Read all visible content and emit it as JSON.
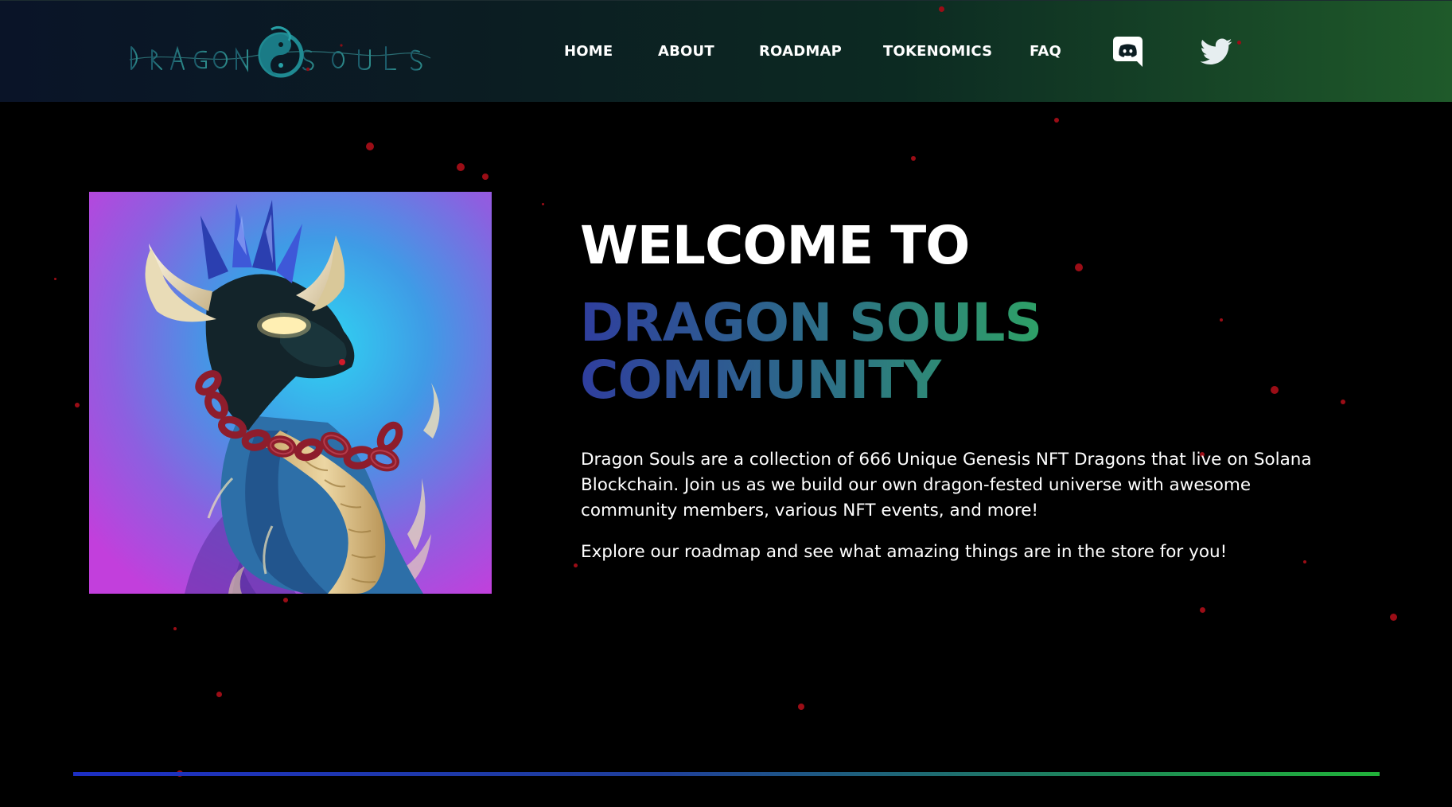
{
  "header": {
    "logo_text": "DRAGON SOULS",
    "nav": [
      {
        "label": "HOME"
      },
      {
        "label": "ABOUT"
      },
      {
        "label": "ROADMAP"
      },
      {
        "label": "TOKENOMICS"
      },
      {
        "label": "FAQ"
      }
    ],
    "social": [
      {
        "icon": "discord-icon"
      },
      {
        "icon": "twitter-icon"
      }
    ]
  },
  "hero": {
    "heading_line1": "WELCOME TO",
    "heading_line2": "DRAGON SOULS COMMUNITY",
    "paragraph1": "Dragon Souls are a collection of 666 Unique Genesis NFT Dragons that live on Solana Blockchain. Join us as we build our own dragon-fested universe with awesome community members, various NFT events, and more!",
    "paragraph2": "Explore our roadmap and see what amazing things are in the store for you!"
  },
  "colors": {
    "background": "#000000",
    "header_start": "#0a1428",
    "header_end": "#1f5a2a",
    "heading_gradient_start": "#2f3e9e",
    "heading_gradient_end": "#2ea862",
    "particle": "#9b0d16",
    "divider_start": "#1d2fc4",
    "divider_end": "#21b23a"
  }
}
